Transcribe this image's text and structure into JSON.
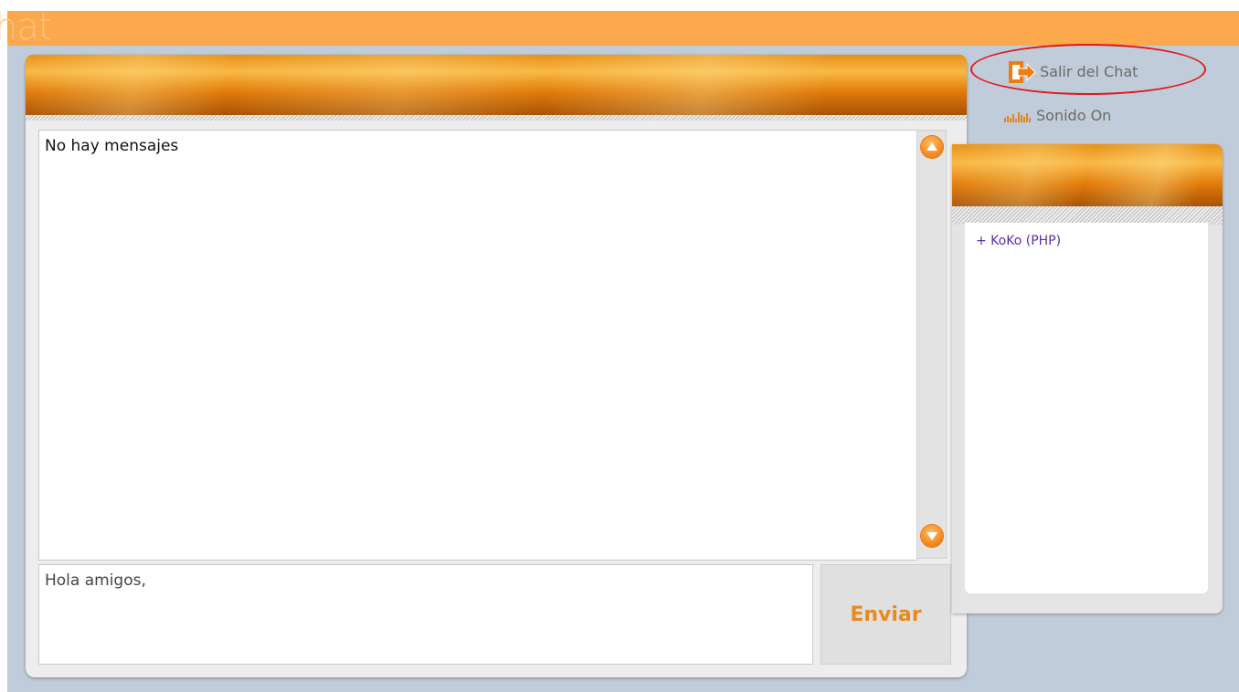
{
  "app": {
    "banner_title": "hat"
  },
  "chat": {
    "messages_placeholder": "No hay mensajes",
    "input_value": "Hola amigos,",
    "send_label": "Enviar"
  },
  "top_links": {
    "exit_label": "Salir del Chat",
    "exit_icon": "exit-door-arrow-icon",
    "sound_label": "Sonido On",
    "sound_icon": "sound-bars-icon"
  },
  "users": {
    "items": [
      {
        "label": "+ KoKo (PHP)"
      }
    ]
  },
  "colors": {
    "banner": "#fca84c",
    "background": "#c0ccd9",
    "accent": "#f58b1e",
    "send_text": "#e98a1a",
    "user_text": "#5a2ea6",
    "highlight": "#e01818"
  }
}
